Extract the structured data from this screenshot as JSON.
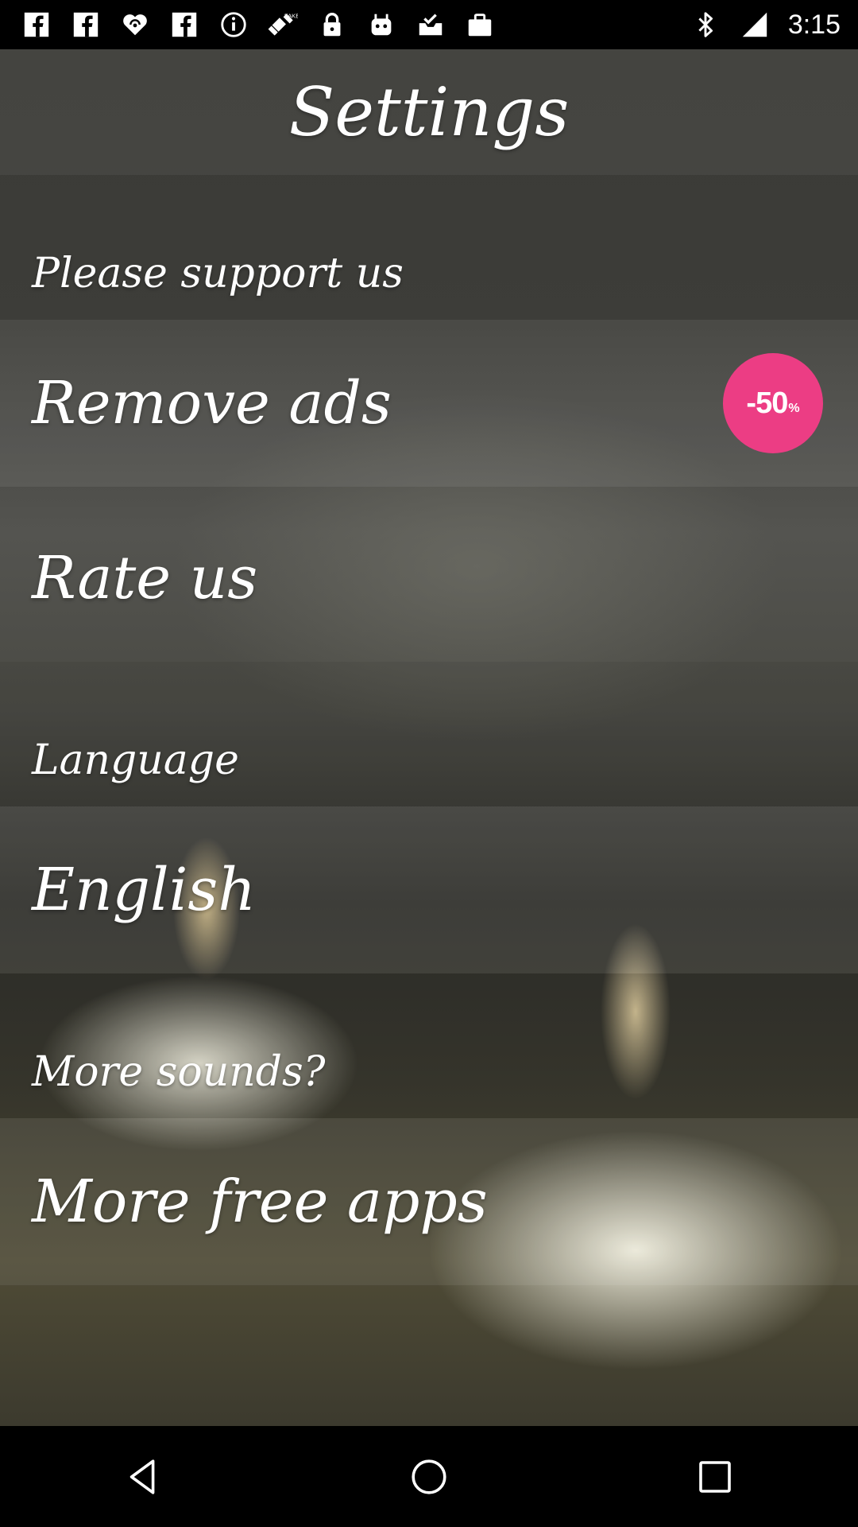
{
  "status_bar": {
    "time": "3:15",
    "left_icons": [
      "facebook-icon",
      "facebook-icon",
      "iheartradio-icon",
      "facebook-icon",
      "info-icon",
      "fake-gps-icon",
      "lock-icon",
      "android-icon",
      "checkbox-tray-icon",
      "briefcase-icon"
    ],
    "right_icons": [
      "bluetooth-icon",
      "signal-icon"
    ]
  },
  "title": "Settings",
  "sections": {
    "support_header": "Please support us",
    "remove_ads": "Remove ads",
    "discount": {
      "value": "-50",
      "unit": "%"
    },
    "rate_us": "Rate us",
    "language_header": "Language",
    "language_value": "English",
    "sounds_header": "More sounds?",
    "more_apps": "More free apps"
  },
  "colors": {
    "badge": "#ec3d84",
    "text": "#ffffff"
  },
  "nav_bar": {
    "buttons": [
      "back-icon",
      "home-icon",
      "recents-icon"
    ]
  }
}
